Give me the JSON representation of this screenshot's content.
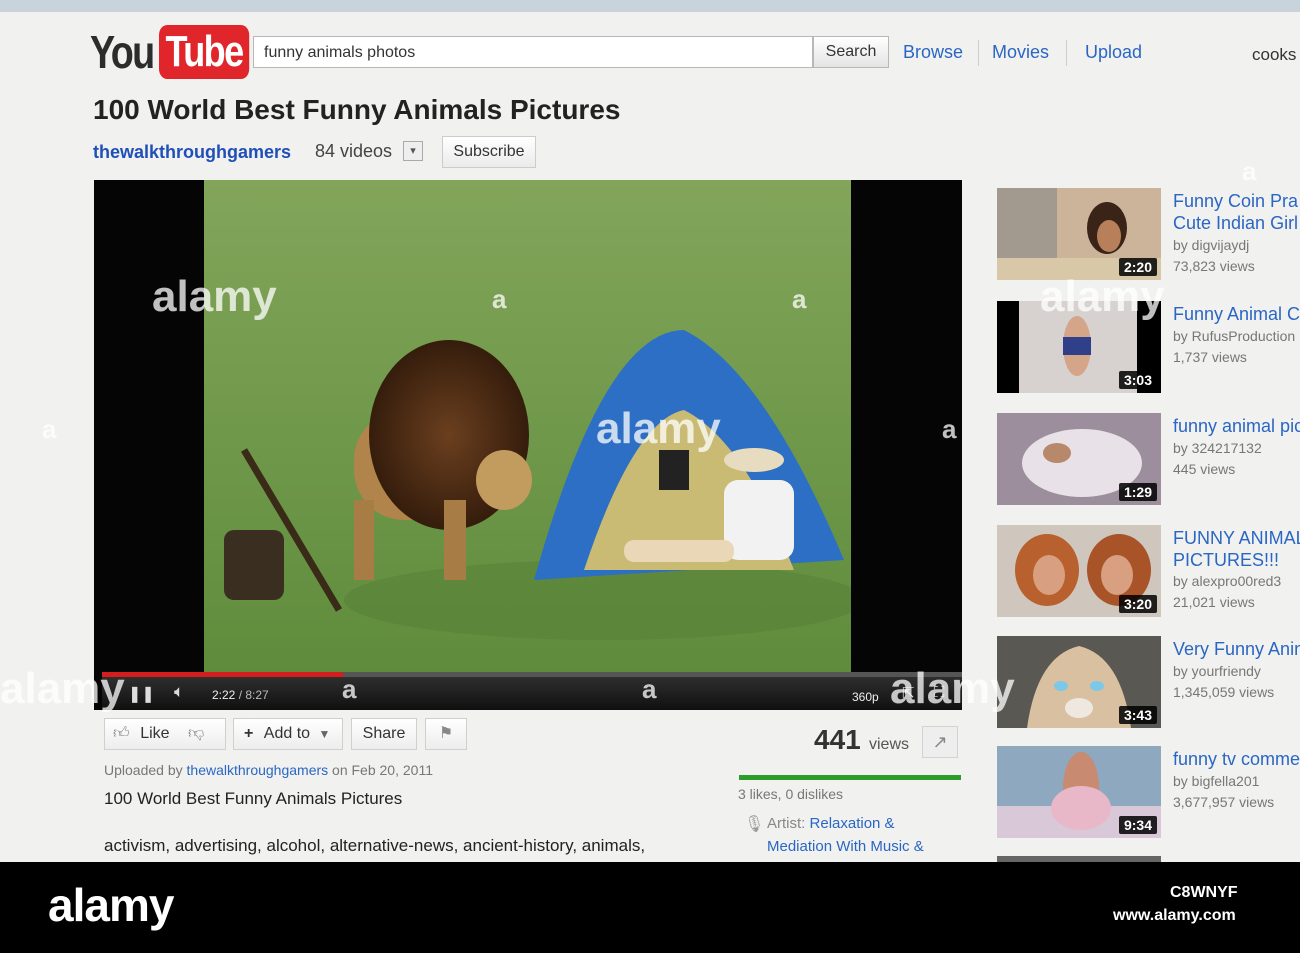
{
  "header": {
    "logo_you": "You",
    "logo_tube": "Tube",
    "search_value": "funny animals photos",
    "search_button": "Search",
    "nav": [
      "Browse",
      "Movies",
      "Upload"
    ],
    "user": "cooks"
  },
  "video": {
    "title": "100 World Best Funny Animals Pictures",
    "channel": "thewalkthroughgamers",
    "video_count": "84 videos",
    "subscribe": "Subscribe",
    "current_time": "2:22",
    "total_time": "/ 8:27",
    "quality": "360p",
    "progress": 0.28
  },
  "actions": {
    "like": "Like",
    "add_to": "Add to",
    "share": "Share"
  },
  "stats": {
    "views": "441",
    "views_label": "views",
    "likes": "3 likes, 0 dislikes"
  },
  "description": {
    "uploaded_prefix": "Uploaded by",
    "uploader": "thewalkthroughgamers",
    "date": "on Feb 20, 2011",
    "title": "100 World Best Funny Animals Pictures",
    "tags": "activism, advertising, alcohol, alternative-news, ancient-history, animals,",
    "artist_label": "Artist:",
    "artist_line1": "Relaxation &",
    "artist_line2": "Mediation With Music &"
  },
  "related": [
    {
      "title": "Funny Coin Pra",
      "title2": "Cute Indian Girl",
      "by": "by digvijaydj",
      "views": "73,823 views",
      "duration": "2:20"
    },
    {
      "title": "Funny Animal C",
      "by": "by RufusProduction",
      "views": "1,737 views",
      "duration": "3:03"
    },
    {
      "title": "funny animal pic",
      "by": "by 324217132",
      "views": "445 views",
      "duration": "1:29"
    },
    {
      "title": "FUNNY ANIMAL",
      "title2": "PICTURES!!!",
      "by": "by alexpro00red3",
      "views": "21,021 views",
      "duration": "3:20"
    },
    {
      "title": "Very Funny Anin",
      "by": "by yourfriendy",
      "views": "1,345,059 views",
      "duration": "3:43"
    },
    {
      "title": "funny tv commer",
      "by": "by bigfella201",
      "views": "3,677,957 views",
      "duration": "9:34"
    }
  ],
  "watermark": {
    "text": "alamy",
    "small": "a",
    "image_id": "C8WNYF",
    "url": "www.alamy.com"
  },
  "colors": {
    "link": "#2a66c4",
    "brand_red": "#e0262a",
    "progress": "#d61d1d",
    "like_bar": "#2a9d2a"
  }
}
